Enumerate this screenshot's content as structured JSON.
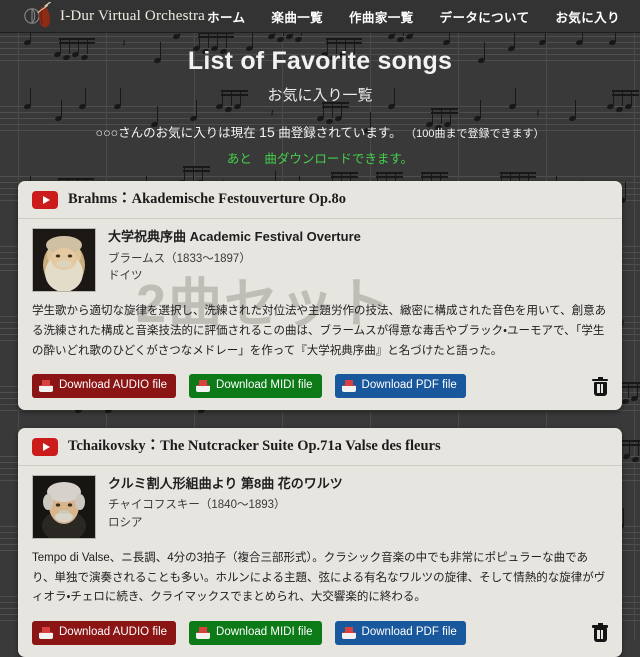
{
  "header": {
    "brand": "I-Dur Virtual Orchestra",
    "logo_icon": "violin-logo-icon",
    "nav": [
      {
        "label": "ホーム",
        "name": "nav-home"
      },
      {
        "label": "楽曲一覧",
        "name": "nav-songs"
      },
      {
        "label": "作曲家一覧",
        "name": "nav-composers"
      },
      {
        "label": "データについて",
        "name": "nav-about-data"
      },
      {
        "label": "お気に入り",
        "name": "nav-favorites"
      }
    ]
  },
  "page": {
    "title": "List of Favorite songs",
    "subtitle": "お気に入り一覧",
    "status_prefix": "○○○さんのお気に入りは現在",
    "status_count": "15",
    "status_suffix": "曲登録されています。",
    "status_note": "（100曲まで登録できます）",
    "download_note": "あと　曲ダウンロードできます。",
    "download_note_color": "#44d04a"
  },
  "buttons": {
    "audio": "Download AUDIO file",
    "midi": "Download MIDI file",
    "pdf": "Download PDF file",
    "audio_color": "#8b1414",
    "midi_color": "#0d7a18",
    "pdf_color": "#19589c",
    "tray_icon": "download-tray-icon",
    "trash_icon": "trash-icon"
  },
  "cards": [
    {
      "play_icon": "youtube-play-icon",
      "title": "Brahms：Akademische Festouverture Op.8o",
      "song_jp": "大学祝典序曲 Academic Festival Overture",
      "composer": "ブラームス（1833〜1897）",
      "country": "ドイツ",
      "portrait": "brahms-portrait",
      "watermark": "2曲セット",
      "description": "学生歌から適切な旋律を選択し、洗練された対位法や主題労作の技法、緻密に構成された音色を用いて、創意ある洗練された構成と音楽技法的に評価されるこの曲は、ブラームスが得意な毒舌やブラック・ユーモアで、「学生の酔いどれ歌のひどくがさつなメドレー」を作って『大学祝典序曲』と名づけたと語った。"
    },
    {
      "play_icon": "youtube-play-icon",
      "title": "Tchaikovsky：The Nutcracker Suite Op.71a Valse des fleurs",
      "song_jp": "クルミ割人形組曲より 第8曲 花のワルツ",
      "composer": "チャイコフスキー（1840〜1893）",
      "country": "ロシア",
      "portrait": "tchaikovsky-portrait",
      "watermark": "",
      "description": "Tempo di Valse、ニ長調、4分の3拍子（複合三部形式）。クラシック音楽の中でも非常にポピュラーな曲であり、単独で演奏されることも多い。ホルンによる主題、弦による有名なワルツの旋律、そして情熱的な旋律がヴィオラ・チェロに続き、クライマックスでまとめられ、大交響楽的に終わる。"
    }
  ]
}
